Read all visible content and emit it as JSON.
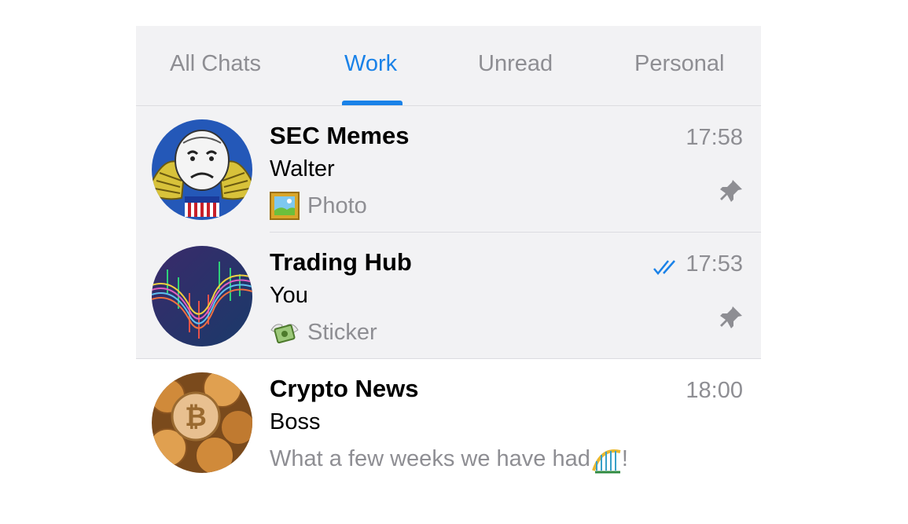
{
  "tabs": [
    {
      "label": "All Chats",
      "active": false
    },
    {
      "label": "Work",
      "active": true
    },
    {
      "label": "Unread",
      "active": false
    },
    {
      "label": "Personal",
      "active": false
    }
  ],
  "colors": {
    "accent": "#1a82e8",
    "secondary_text": "#8e8e93",
    "pinned_bg": "#f2f2f4"
  },
  "chats": [
    {
      "title": "SEC Memes",
      "sender": "Walter",
      "preview": "Photo",
      "preview_icon": "framed-picture-emoji",
      "time": "17:58",
      "pinned": true,
      "read_status": "none"
    },
    {
      "title": "Trading Hub",
      "sender": "You",
      "preview": "Sticker",
      "preview_icon": "money-with-wings-emoji",
      "time": "17:53",
      "pinned": true,
      "read_status": "double-check"
    },
    {
      "title": "Crypto News",
      "sender": "Boss",
      "preview": "What a few weeks we have had",
      "preview_suffix": "!",
      "preview_trailing_icon": "roller-coaster-emoji",
      "time": "18:00",
      "pinned": false,
      "read_status": "none"
    }
  ]
}
